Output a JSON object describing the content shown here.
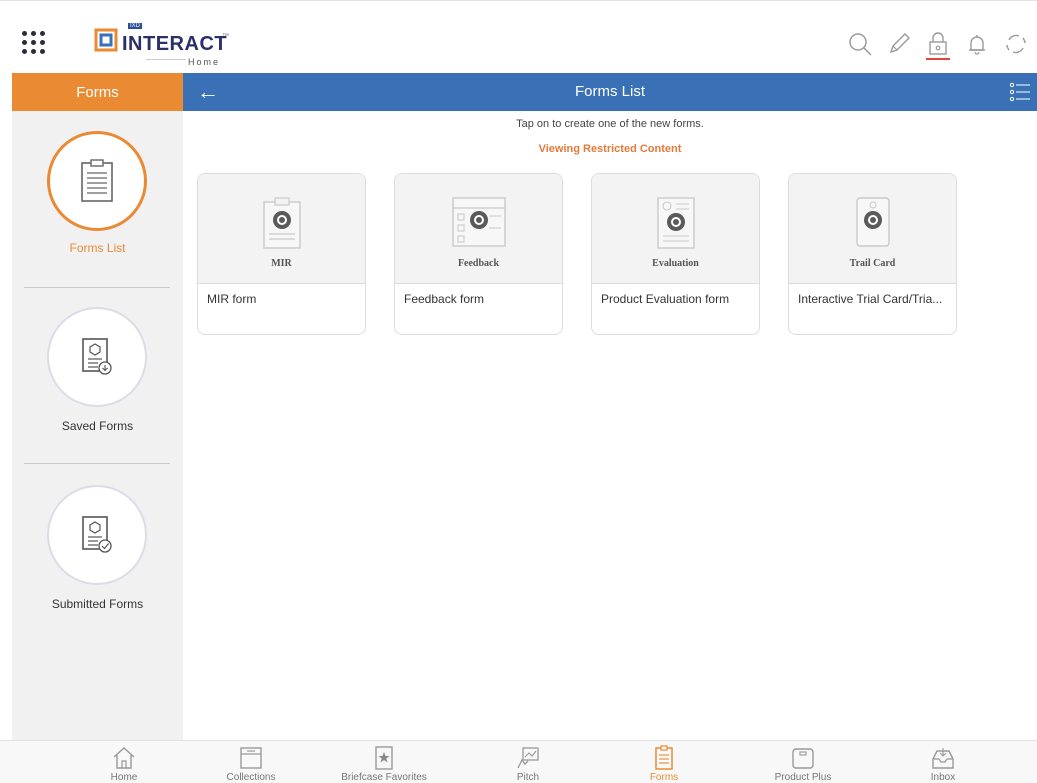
{
  "brand": {
    "logo_text": "INTERACT",
    "logo_tm": "™",
    "logo_badge": "IXD",
    "subtitle": "Home"
  },
  "top_actions": [
    {
      "icon": "search-icon"
    },
    {
      "icon": "pencil-icon"
    },
    {
      "icon": "lock-icon"
    },
    {
      "icon": "bell-icon"
    },
    {
      "icon": "sync-icon"
    }
  ],
  "section_header": {
    "left_title": "Forms",
    "back": "←",
    "title": "Forms List"
  },
  "sidebar": {
    "items": [
      {
        "label": "Forms List",
        "icon": "clipboard-list-icon",
        "active": true
      },
      {
        "label": "Saved Forms",
        "icon": "saved-form-icon",
        "active": false
      },
      {
        "label": "Submitted Forms",
        "icon": "submitted-form-icon",
        "active": false
      }
    ]
  },
  "main": {
    "hint": "Tap on to create one of the new forms.",
    "restricted": "Viewing Restricted Content",
    "cards": [
      {
        "thumb_title": "MIR",
        "label": "MIR form"
      },
      {
        "thumb_title": "Feedback",
        "label": "Feedback form"
      },
      {
        "thumb_title": "Evaluation",
        "label": "Product Evaluation form"
      },
      {
        "thumb_title": "Trail Card",
        "label": "Interactive Trial Card/Tria..."
      }
    ]
  },
  "bottom_tabs": [
    {
      "label": "Home",
      "icon": "home-icon",
      "active": false
    },
    {
      "label": "Collections",
      "icon": "collections-icon",
      "active": false
    },
    {
      "label": "Briefcase Favorites",
      "icon": "briefcase-star-icon",
      "active": false
    },
    {
      "label": "Pitch",
      "icon": "pitch-icon",
      "active": false
    },
    {
      "label": "Forms",
      "icon": "forms-icon",
      "active": true
    },
    {
      "label": "Product Plus",
      "icon": "product-plus-icon",
      "active": false
    },
    {
      "label": "Inbox",
      "icon": "inbox-icon",
      "active": false
    }
  ],
  "colors": {
    "accent_orange": "#ea8a33",
    "header_blue": "#3a71b6",
    "restricted_text": "#e27a3a",
    "sidebar_bg": "#f1f1f2"
  }
}
